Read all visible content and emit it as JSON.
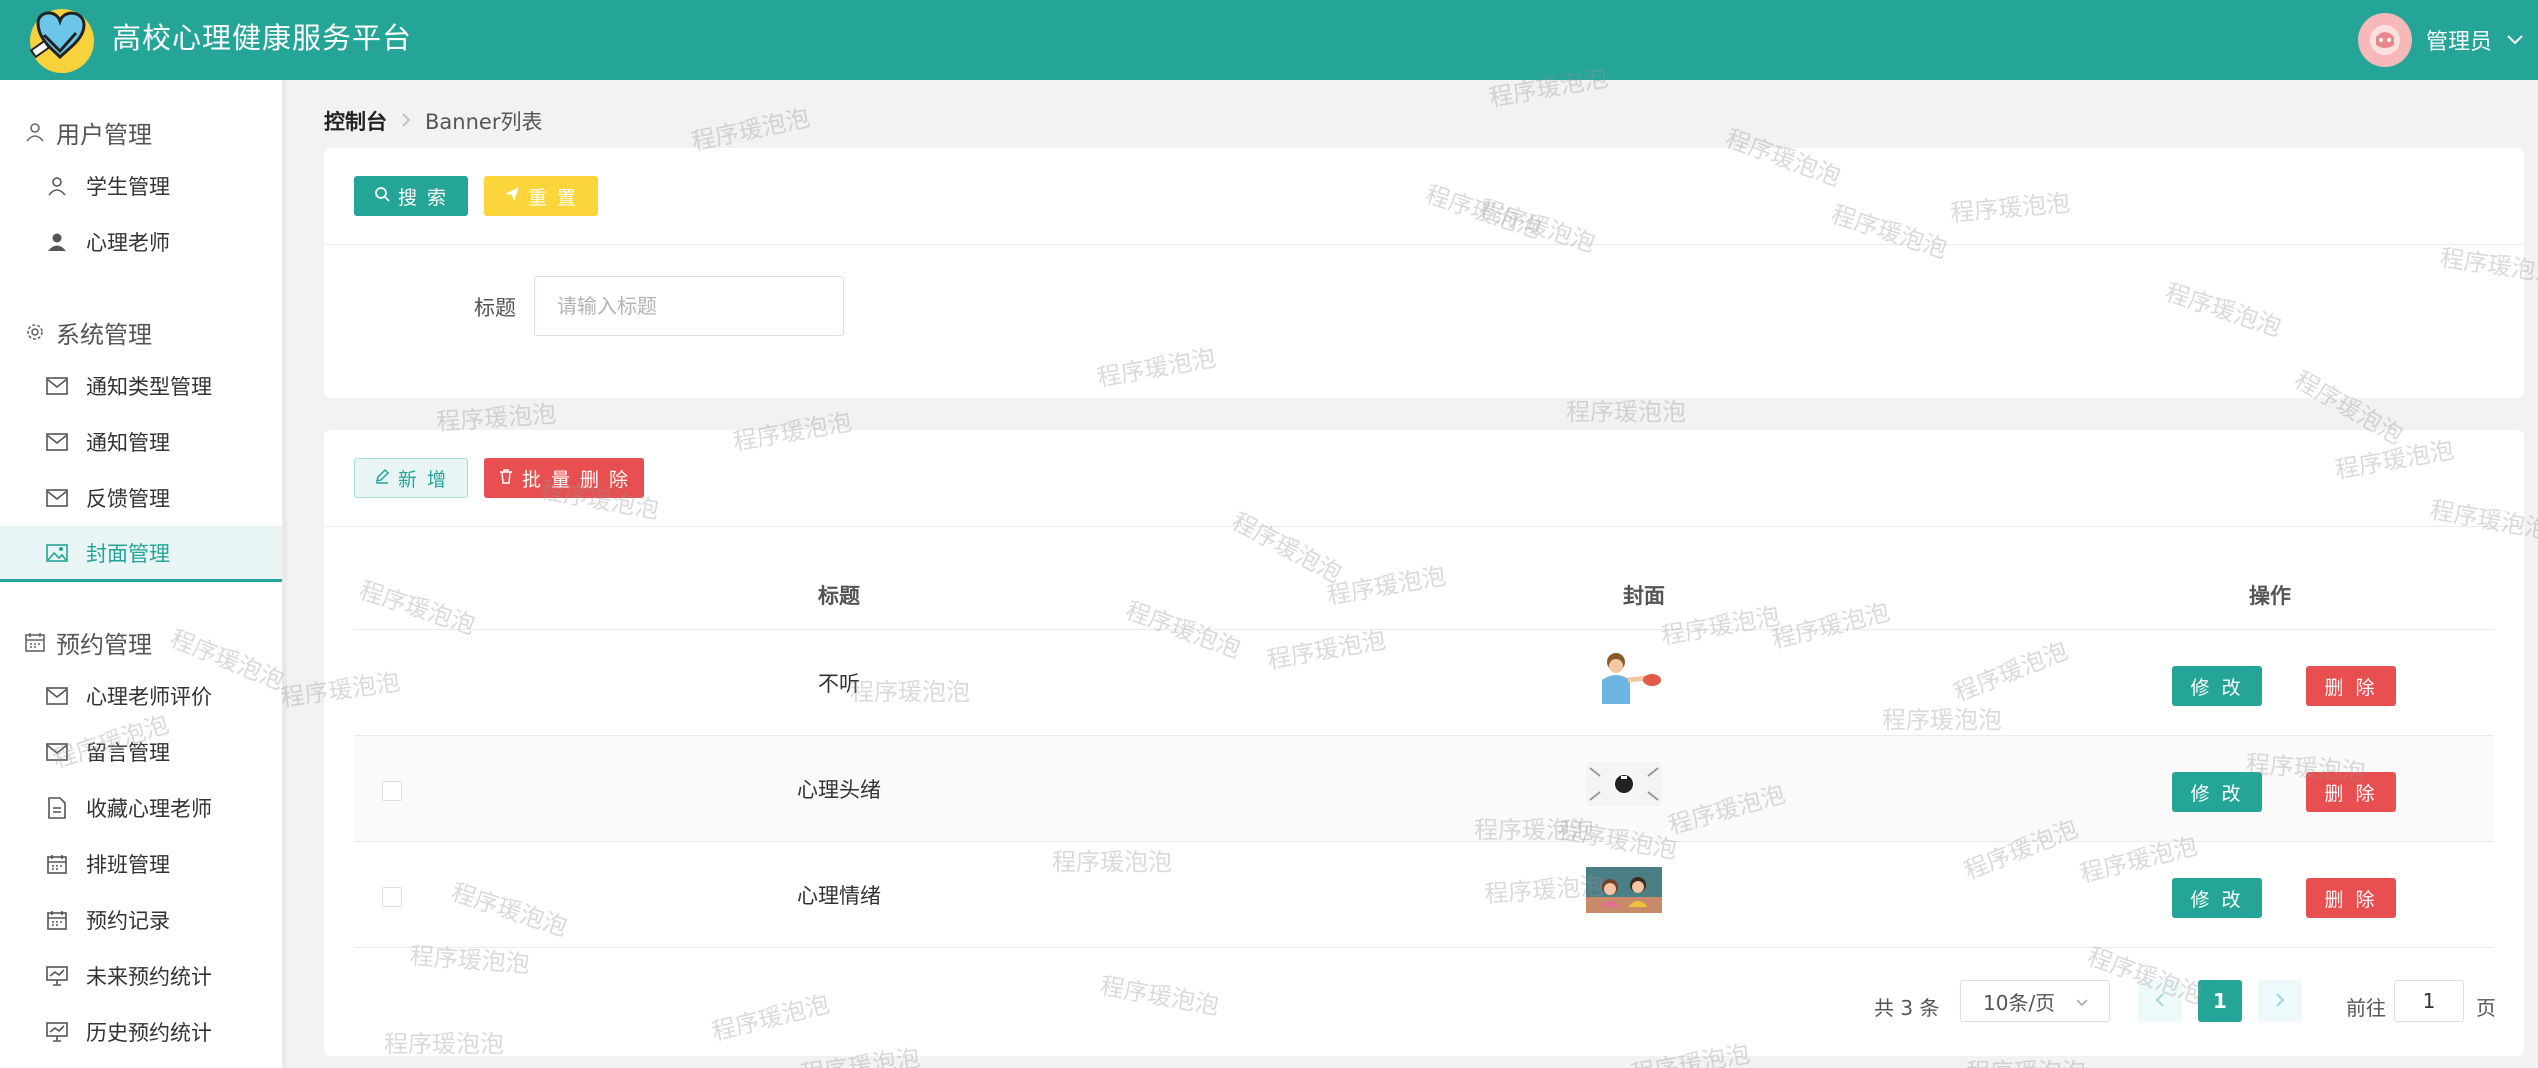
{
  "header": {
    "app_title": "高校心理健康服务平台",
    "user_name": "管理员"
  },
  "sidebar": {
    "groups": [
      {
        "title": "用户管理",
        "items": [
          {
            "label": "学生管理"
          },
          {
            "label": "心理老师"
          }
        ]
      },
      {
        "title": "系统管理",
        "items": [
          {
            "label": "通知类型管理"
          },
          {
            "label": "通知管理"
          },
          {
            "label": "反馈管理"
          },
          {
            "label": "封面管理"
          }
        ]
      },
      {
        "title": "预约管理",
        "items": [
          {
            "label": "心理老师评价"
          },
          {
            "label": "留言管理"
          },
          {
            "label": "收藏心理老师"
          },
          {
            "label": "排班管理"
          },
          {
            "label": "预约记录"
          },
          {
            "label": "未来预约统计"
          },
          {
            "label": "历史预约统计"
          }
        ]
      }
    ],
    "active_item": "封面管理"
  },
  "breadcrumb": {
    "home": "控制台",
    "current": "Banner列表"
  },
  "search": {
    "search_label": "搜 索",
    "reset_label": "重 置",
    "field_label": "标题",
    "placeholder": "请输入标题"
  },
  "toolbar": {
    "add_label": "新 增",
    "batch_delete_label": "批 量 删 除"
  },
  "table": {
    "columns": [
      "标题",
      "封面",
      "操作"
    ],
    "rows": [
      {
        "title": "不听",
        "edit_label": "修 改",
        "delete_label": "删 除"
      },
      {
        "title": "心理头绪",
        "edit_label": "修 改",
        "delete_label": "删 除"
      },
      {
        "title": "心理情绪",
        "edit_label": "修 改",
        "delete_label": "删 除"
      }
    ]
  },
  "pagination": {
    "total_text": "共 3 条",
    "page_size": "10条/页",
    "current_page": "1",
    "goto_prefix": "前往",
    "goto_value": "1",
    "goto_suffix": "页"
  },
  "watermark": "程序瑗泡泡",
  "colors": {
    "primary": "#25a598",
    "warning": "#fcd53b",
    "danger": "#e84f50"
  }
}
